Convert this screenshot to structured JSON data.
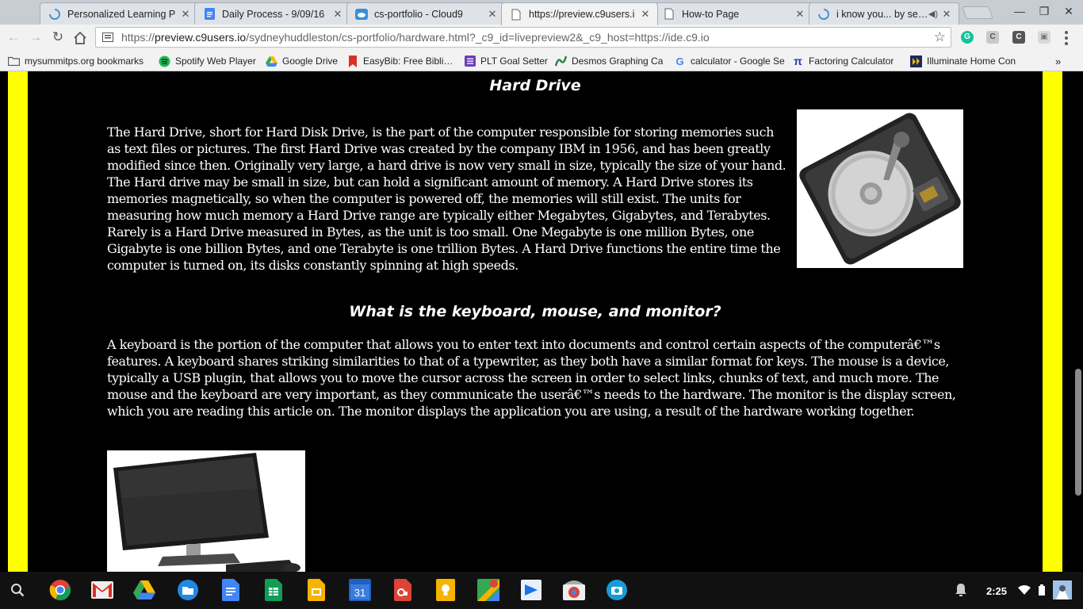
{
  "tabs": [
    {
      "title": "Personalized Learning P",
      "icon": "loading-spinner-icon",
      "active": false
    },
    {
      "title": "Daily Process - 9/09/16",
      "icon": "google-docs-icon",
      "active": false
    },
    {
      "title": "cs-portfolio - Cloud9",
      "icon": "cloud9-icon",
      "active": false
    },
    {
      "title": "https://preview.c9users.i",
      "icon": "page-icon",
      "active": true
    },
    {
      "title": "How-to Page",
      "icon": "page-icon",
      "active": false
    },
    {
      "title": "i know you... by seiji o",
      "icon": "loading-spinner-icon",
      "active": false
    }
  ],
  "toolbar": {
    "url_prefix": "https://",
    "url_host": "preview.c9users.io",
    "url_path": "/sydneyhuddleston/cs-portfolio/hardware.html?_c9_id=livepreview2&_c9_host=https://ide.c9.io"
  },
  "bookmarks": [
    {
      "label": "mysummitps.org bookmarks",
      "icon": "folder-icon"
    },
    {
      "label": "Spotify Web Player",
      "icon": "spotify-icon"
    },
    {
      "label": "Google Drive",
      "icon": "google-drive-icon"
    },
    {
      "label": "EasyBib: Free Bibliogr",
      "icon": "easybib-icon"
    },
    {
      "label": "PLT Goal Setter",
      "icon": "plt-icon"
    },
    {
      "label": "Desmos Graphing Ca",
      "icon": "desmos-icon"
    },
    {
      "label": "calculator - Google Se",
      "icon": "google-icon"
    },
    {
      "label": "Factoring Calculator",
      "icon": "pi-icon"
    },
    {
      "label": "Illuminate Home Con",
      "icon": "illuminate-icon"
    }
  ],
  "content": {
    "hard_drive_heading": "Hard Drive",
    "hard_drive_text": "The Hard Drive, short for Hard Disk Drive, is the part of the computer responsible for storing memories such as text files or pictures. The first Hard Drive was created by the company IBM in 1956, and has been greatly modified since then. Originally very large, a hard drive is now very small in size, typically the size of your hand. The Hard drive may be small in size, but can hold a significant amount of memory. A Hard Drive stores its memories magnetically, so when the computer is powered off, the memories will still exist. The units for measuring how much memory a Hard Drive range are typically either Megabytes, Gigabytes, and Terabytes. Rarely is a Hard Drive measured in Bytes, as the unit is too small. One Megabyte is one million Bytes, one Gigabyte is one billion Bytes, and one Terabyte is one trillion Bytes. A Hard Drive functions the entire time the computer is turned on, its disks constantly spinning at high speeds.",
    "peripherals_heading": "What is the keyboard, mouse, and monitor?",
    "peripherals_text": "A keyboard is the portion of the computer that allows you to enter text into documents and control certain aspects of the computerâ€™s features. A keyboard shares striking similarities to that of a typewriter, as they both have a similar format for keys. The mouse is a device, typically a USB plugin, that allows you to move the cursor across the screen in order to select links, chunks of text, and much more. The mouse and the keyboard are very important, as they communicate the userâ€™s needs to the hardware. The monitor is the display screen, which you are reading this article on. The monitor displays the application you are using, a result of the hardware working together."
  },
  "colors": {
    "page_background": "#000000",
    "side_bar": "#ffff00",
    "text": "#ffffff"
  },
  "shelf": {
    "apps": [
      "search-icon",
      "chrome-icon",
      "gmail-icon",
      "google-drive-icon",
      "files-icon",
      "google-docs-icon",
      "google-sheets-icon",
      "google-slides-icon",
      "google-calendar-icon",
      "google-office-icon",
      "google-keep-icon",
      "google-maps-icon",
      "wevideo-icon",
      "chrome-webstore-icon",
      "camera-icon"
    ],
    "calendar_day": "31",
    "time": "2:25"
  }
}
